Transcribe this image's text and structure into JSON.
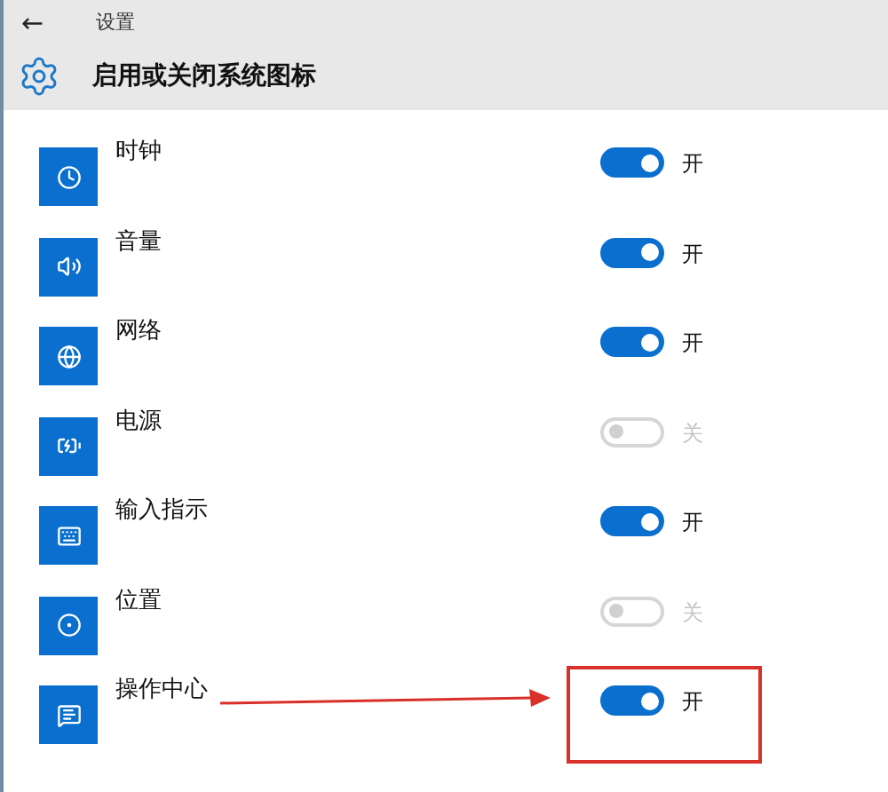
{
  "header": {
    "back": "←",
    "title": "设置"
  },
  "page_title": "启用或关闭系统图标",
  "items": [
    {
      "label": "时钟",
      "kind": "clock",
      "on": true,
      "state": "开"
    },
    {
      "label": "音量",
      "kind": "volume",
      "on": true,
      "state": "开"
    },
    {
      "label": "网络",
      "kind": "network",
      "on": true,
      "state": "开"
    },
    {
      "label": "电源",
      "kind": "power",
      "on": false,
      "state": "关"
    },
    {
      "label": "输入指示",
      "kind": "input",
      "on": true,
      "state": "开"
    },
    {
      "label": "位置",
      "kind": "location",
      "on": false,
      "state": "关"
    },
    {
      "label": "操作中心",
      "kind": "action",
      "on": true,
      "state": "开"
    }
  ]
}
